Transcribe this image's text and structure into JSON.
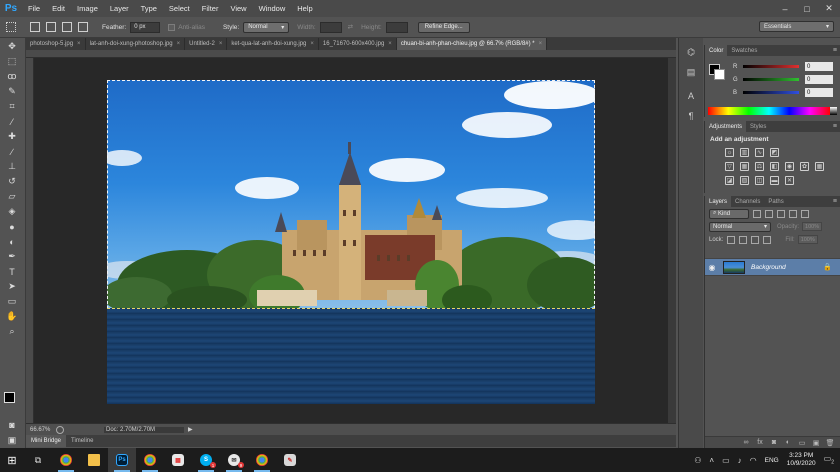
{
  "app": {
    "logo": "Ps"
  },
  "menu": [
    "File",
    "Edit",
    "Image",
    "Layer",
    "Type",
    "Select",
    "Filter",
    "View",
    "Window",
    "Help"
  ],
  "window_controls": {
    "minimize": "–",
    "maximize": "□",
    "close": "✕"
  },
  "options": {
    "feather_label": "Feather:",
    "feather_value": "0 px",
    "anti_alias_label": "Anti-alias",
    "style_label": "Style:",
    "style_value": "Normal",
    "width_label": "Width:",
    "height_label": "Height:",
    "refine_edge": "Refine Edge...",
    "workspace": "Essentials"
  },
  "doc_tabs": [
    {
      "label": "photoshop-5.jpg",
      "active": false
    },
    {
      "label": "lat-anh-doi-xung-photoshop.jpg",
      "active": false
    },
    {
      "label": "Untitled-2",
      "active": false
    },
    {
      "label": "ket-qua-lat-anh-doi-xung.jpg",
      "active": false
    },
    {
      "label": "16_71670-600x400.jpg",
      "active": false
    },
    {
      "label": "chuan-bi-anh-phan-chieu.jpg @ 66.7% (RGB/8#) *",
      "active": true
    }
  ],
  "status": {
    "zoom": "66.67%",
    "doc": "Doc: 2.70M/2.70M"
  },
  "bottom_tabs": [
    "Mini Bridge",
    "Timeline"
  ],
  "color_panel": {
    "tabs": [
      "Color",
      "Swatches"
    ],
    "sliders": [
      {
        "label": "R",
        "value": "0",
        "color": "#e03030"
      },
      {
        "label": "G",
        "value": "0",
        "color": "#30c030"
      },
      {
        "label": "B",
        "value": "0",
        "color": "#3050e0"
      }
    ]
  },
  "adjustments_panel": {
    "tabs": [
      "Adjustments",
      "Styles"
    ],
    "title": "Add an adjustment",
    "row1_icons": [
      "brightness-icon",
      "levels-icon",
      "curves-icon",
      "exposure-icon"
    ],
    "row2_icons": [
      "vibrance-icon",
      "hue-saturation-icon",
      "color-balance-icon",
      "black-white-icon",
      "photo-filter-icon",
      "channel-mixer-icon",
      "color-lookup-icon"
    ],
    "row3_icons": [
      "invert-icon",
      "posterize-icon",
      "threshold-icon",
      "gradient-map-icon",
      "selective-color-icon"
    ]
  },
  "layers_panel": {
    "tabs": [
      "Layers",
      "Channels",
      "Paths"
    ],
    "kind_label": "Kind",
    "blend_mode": "Normal",
    "opacity_label": "Opacity:",
    "opacity_value": "100%",
    "lock_label": "Lock:",
    "fill_label": "Fill:",
    "fill_value": "100%",
    "layers": [
      {
        "name": "Background",
        "visible": true,
        "locked": true
      }
    ]
  },
  "taskbar": {
    "lang": "ENG",
    "time": "3:23 PM",
    "date": "10/9/2020",
    "notification_count": "2"
  }
}
